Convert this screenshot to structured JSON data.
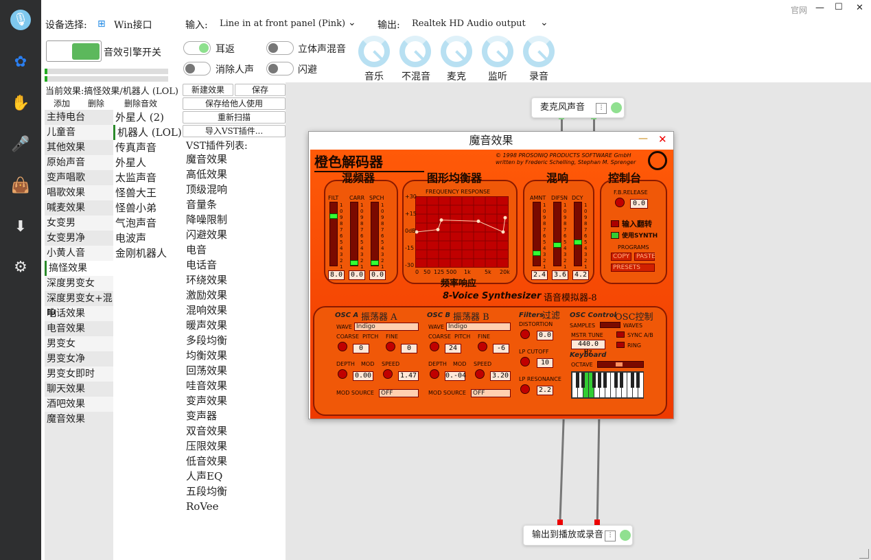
{
  "window": {
    "official_link": "官网",
    "minimize": "—",
    "maximize": "☐",
    "close": "✕"
  },
  "sidebar": {
    "items": [
      "microphone-logo",
      "flower-icon",
      "hand-icon",
      "mic-icon",
      "bag-icon",
      "download-icon",
      "gear-icon"
    ]
  },
  "device": {
    "label": "设备选择:",
    "value": "Win接口"
  },
  "engine": {
    "label": "音效引擎开关"
  },
  "io": {
    "input_label": "输入:",
    "input_value": "Line in at front panel (Pink)",
    "output_label": "输出:",
    "output_value": "Realtek HD Audio output"
  },
  "toggles": [
    {
      "label": "耳返",
      "on": true
    },
    {
      "label": "立体声混音",
      "on": false
    },
    {
      "label": "消除人声",
      "on": false
    },
    {
      "label": "闪避",
      "on": false
    }
  ],
  "dials": [
    "音乐",
    "不混音",
    "麦克",
    "监听",
    "录音"
  ],
  "current_effect": "当前效果:搞怪效果/机器人 (LOL)",
  "effect_actions": [
    "添加",
    "删除",
    "删除音效"
  ],
  "categories": [
    "主持电台",
    "儿童音",
    "其他效果",
    "原始声音",
    "变声唱歌",
    "唱歌效果",
    "喊麦效果",
    "女变男",
    "女变男净",
    "小黄人音",
    "搞怪效果",
    "深度男变女",
    "深度男变女+混响",
    "电话效果",
    "电音效果",
    "男变女",
    "男变女净",
    "男变女即时",
    "聊天效果",
    "酒吧效果",
    "魔音效果"
  ],
  "selected_category": 10,
  "subeffects": [
    "外星人 (2)",
    "机器人 (LOL)",
    "传真声音",
    "外星人",
    "太监声音",
    "怪兽大王",
    "怪兽小弟",
    "气泡声音",
    "电波声",
    "金刚机器人"
  ],
  "selected_subeffect": 1,
  "vst_buttons": {
    "new": "新建效果",
    "save": "保存",
    "share": "保存给他人使用",
    "rescan": "重新扫描",
    "import": "导入VST插件..."
  },
  "vst_list_title": "VST插件列表:",
  "vst_list": [
    "魔音效果",
    "高低效果",
    "顶级混响",
    "音量条",
    "降噪限制",
    "闪避效果",
    "电音",
    "电话音",
    "环绕效果",
    "激励效果",
    "混响效果",
    "暖声效果",
    "多段均衡",
    "均衡效果",
    "回荡效果",
    "哇音效果",
    "变声效果",
    "变声器",
    "双音效果",
    "压限效果",
    "低音效果",
    "人声EQ",
    "五段均衡",
    "RoVee"
  ],
  "nodes": {
    "mic": "麦克风声音",
    "out": "输出到播放或录音"
  },
  "plugin": {
    "title": "魔音效果",
    "brand": "橙色解码器",
    "copyright1": "© 1998 PROSONIQ PRODUCTS SOFTWARE GmbH",
    "copyright2": "written by Frederic Schelling, Stephan M. Sprenger",
    "mixer_title": "混频器",
    "eq_title": "图形均衡器",
    "reverb_title": "混响",
    "control_title": "控制台",
    "mixer_labels": [
      "FILT",
      "CARR",
      "SPCH"
    ],
    "mixer_values": [
      "8.0",
      "0.0",
      "0.0"
    ],
    "eq_label": "FREQUENCY RESPONSE",
    "eq_y_ticks": [
      "+30",
      "+15",
      "0dB",
      "-15",
      "-30"
    ],
    "eq_x_ticks": [
      "0",
      "50",
      "125",
      "500",
      "1k",
      "5k",
      "20k"
    ],
    "eq_caption": "频率响应",
    "reverb_labels": [
      "AMNT",
      "DIFSN",
      "DCY"
    ],
    "reverb_values": [
      "2.4",
      "3.6",
      "4.2"
    ],
    "fb_release": "F.B.RELEASE",
    "fb_value": "0.0",
    "invert_input": "输入翻转",
    "use_synth": "使用SYNTH",
    "programs": "PROGRAMS",
    "copy": "COPY",
    "paste": "PASTE",
    "presets": "PRESETS",
    "synth_title": "8-Voice Synthesizer",
    "synth_cn": "语音模拟器-8",
    "osc_a": "OSC A",
    "osc_a_cn": "振荡器 A",
    "osc_b": "OSC B",
    "osc_b_cn": "振荡器 B",
    "filters": "Filters",
    "filters_cn": "过滤",
    "osc_control": "OSC Control",
    "osc_control_cn": "OSC控制",
    "wave": "WAVE",
    "wave_value": "Indigo",
    "coarse": "COARSE",
    "pitch": "PITCH",
    "fine": "FINE",
    "osc_a_coarse": "0",
    "osc_a_fine": "0",
    "osc_a_depth": "0.00",
    "osc_a_speed": "1.47",
    "osc_b_coarse": "24",
    "osc_b_fine": "-6",
    "osc_b_depth": "0.-04",
    "osc_b_speed": "3.20",
    "depth": "DEPTH",
    "mod": "MOD",
    "speed": "SPEED",
    "mod_source": "MOD SOURCE",
    "mod_source_value": "OFF",
    "distortion": "DISTORTION",
    "distortion_value": "0.0",
    "lp_cutoff": "LP CUTOFF",
    "lp_cutoff_value": "10",
    "lp_resonance": "LP RESONANCE",
    "lp_resonance_value": "2.2",
    "samples": "SAMPLES",
    "waves": "WAVES",
    "mstr_tune": "MSTR TUNE",
    "mstr_tune_value": "440.0 Hz",
    "sync": "SYNC A/B",
    "ring": "RING",
    "keyboard": "Keyboard",
    "octave": "OCTAVE",
    "eq_curve": [
      0,
      2,
      10,
      9,
      0,
      12
    ]
  }
}
